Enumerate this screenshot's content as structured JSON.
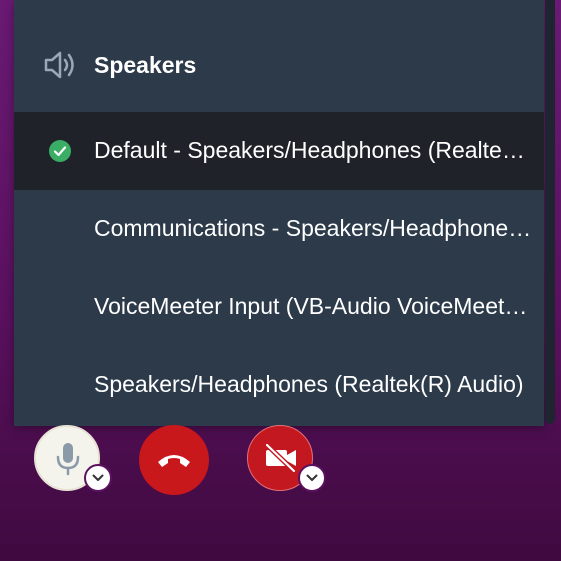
{
  "menu": {
    "header": {
      "label": "Speakers",
      "icon": "speaker-icon"
    },
    "items": [
      {
        "label": "Default - Speakers/Headphones (Realtek(R) Audio)",
        "selected": true
      },
      {
        "label": "Communications - Speakers/Headphones (Realtek(R) Audio)",
        "selected": false
      },
      {
        "label": "VoiceMeeter Input (VB-Audio VoiceMeeter VAIO)",
        "selected": false
      },
      {
        "label": "Speakers/Headphones (Realtek(R) Audio)",
        "selected": false
      }
    ]
  },
  "controls": {
    "microphone": {
      "icon": "microphone-icon",
      "has_menu": true
    },
    "hangup": {
      "icon": "hang-up-icon"
    },
    "camera": {
      "icon": "camera-off-icon",
      "state": "off",
      "has_menu": true
    }
  },
  "colors": {
    "menu_bg": "#2c3a4a",
    "selected_bg": "#1f2229",
    "check": "#3aae64",
    "hangup": "#c9181b",
    "camera_off": "#c31820",
    "background": "#5a115f"
  }
}
